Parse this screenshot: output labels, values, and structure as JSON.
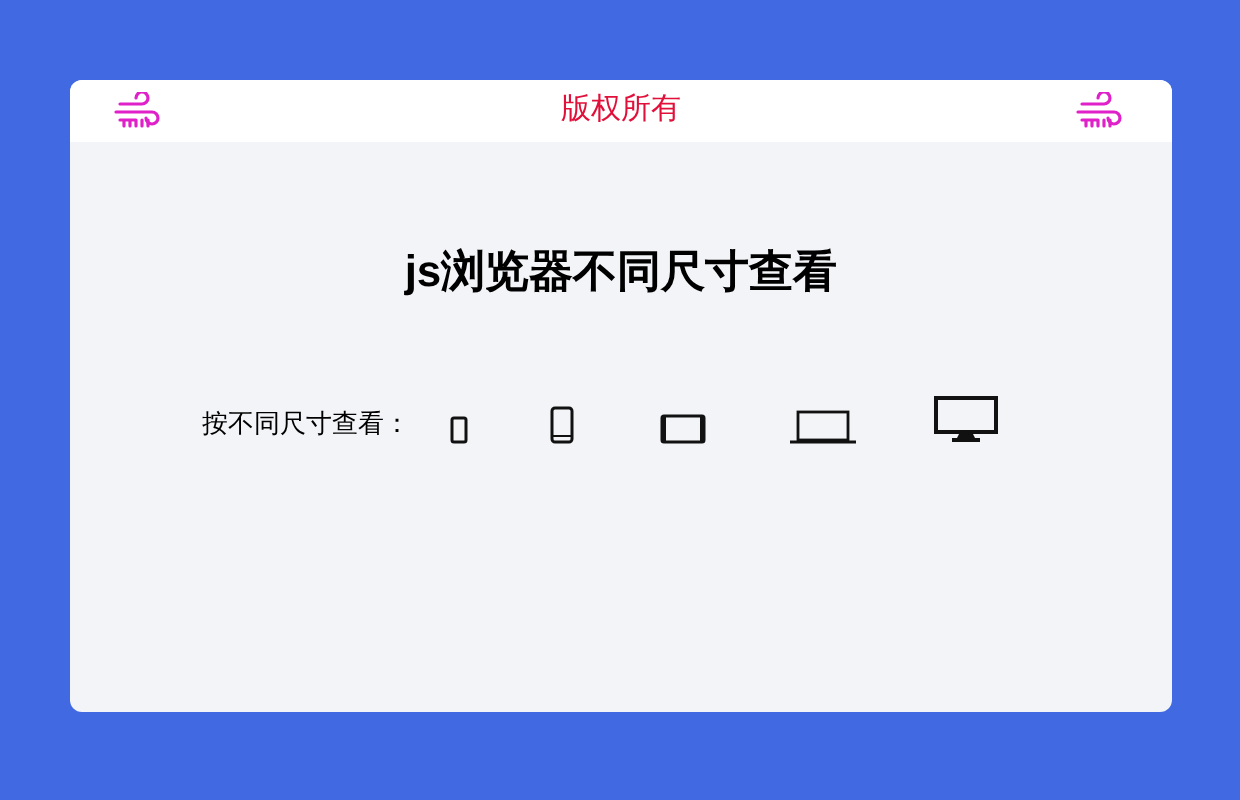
{
  "header": {
    "text": "版权所有"
  },
  "title": "js浏览器不同尺寸查看",
  "size_label": "按不同尺寸查看：",
  "devices": [
    {
      "kind": "small-phone"
    },
    {
      "kind": "phone"
    },
    {
      "kind": "tablet"
    },
    {
      "kind": "laptop"
    },
    {
      "kind": "monitor"
    }
  ]
}
